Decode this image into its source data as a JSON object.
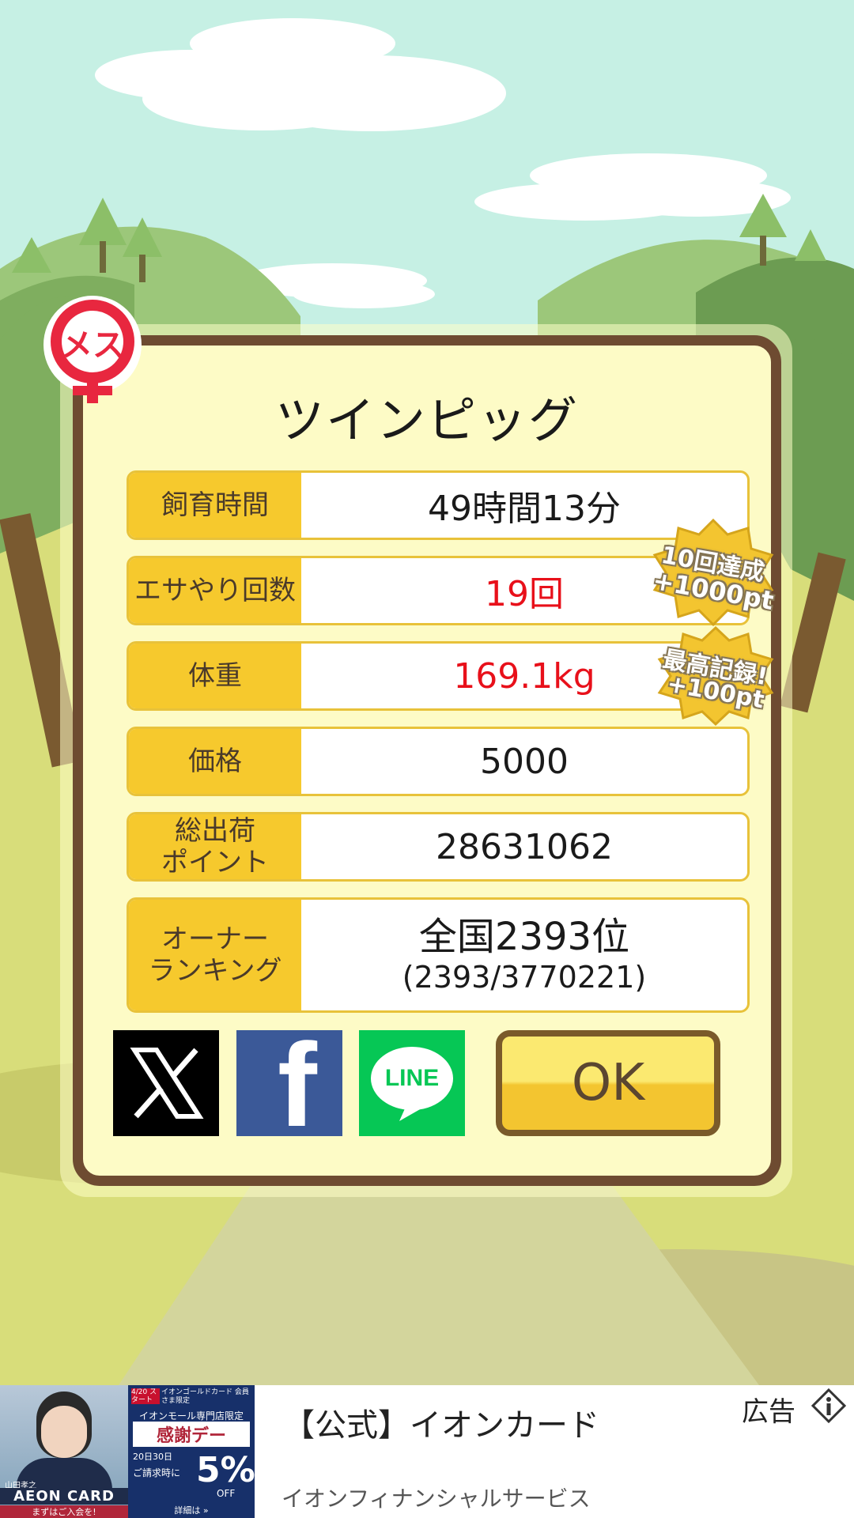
{
  "pig": {
    "name": "ツインピッグ",
    "gender_label": "メス"
  },
  "stats": [
    {
      "label": "飼育時間",
      "value": "49時間13分",
      "highlight": false
    },
    {
      "label": "エサやり回数",
      "value": "19回",
      "highlight": true
    },
    {
      "label": "体重",
      "value": "169.1kg",
      "highlight": true
    },
    {
      "label": "価格",
      "value": "5000",
      "highlight": false
    },
    {
      "label": "総出荷\nポイント",
      "value": "28631062",
      "highlight": false
    }
  ],
  "ranking": {
    "label": "オーナー\nランキング",
    "main": "全国2393位",
    "sub": "(2393/3770221)"
  },
  "badges": [
    {
      "line1": "10回達成",
      "line2": "+1000pt"
    },
    {
      "line1": "最高記録!",
      "line2": "+100pt"
    }
  ],
  "buttons": {
    "ok_label": "OK",
    "line_label": "LINE",
    "x_label": "X",
    "facebook_label": "f"
  },
  "ad": {
    "title": "【公式】イオンカード",
    "advertiser": "イオンフィナンシャルサービス",
    "ad_label": "広告",
    "image_texts": {
      "card": "AEON CARD",
      "join": "まずはご入会を!",
      "date": "4/20 スタート",
      "gold": "イオンゴールドカード 会員さま限定",
      "mall": "イオンモール専門店限定",
      "thanks": "感謝デー",
      "days": "20日30日",
      "billing": "ご請求時に",
      "discount": "5%",
      "off": "OFF",
      "details": "詳細は »",
      "caption": "山田孝之"
    }
  },
  "colors": {
    "sky": "#c6f0e4",
    "dialog_bg": "#fdfbc6",
    "dialog_border": "#6e4b31",
    "label_bg": "#f6c92d",
    "highlight_text": "#e8101a",
    "facebook": "#3b5998",
    "line": "#06c755"
  }
}
